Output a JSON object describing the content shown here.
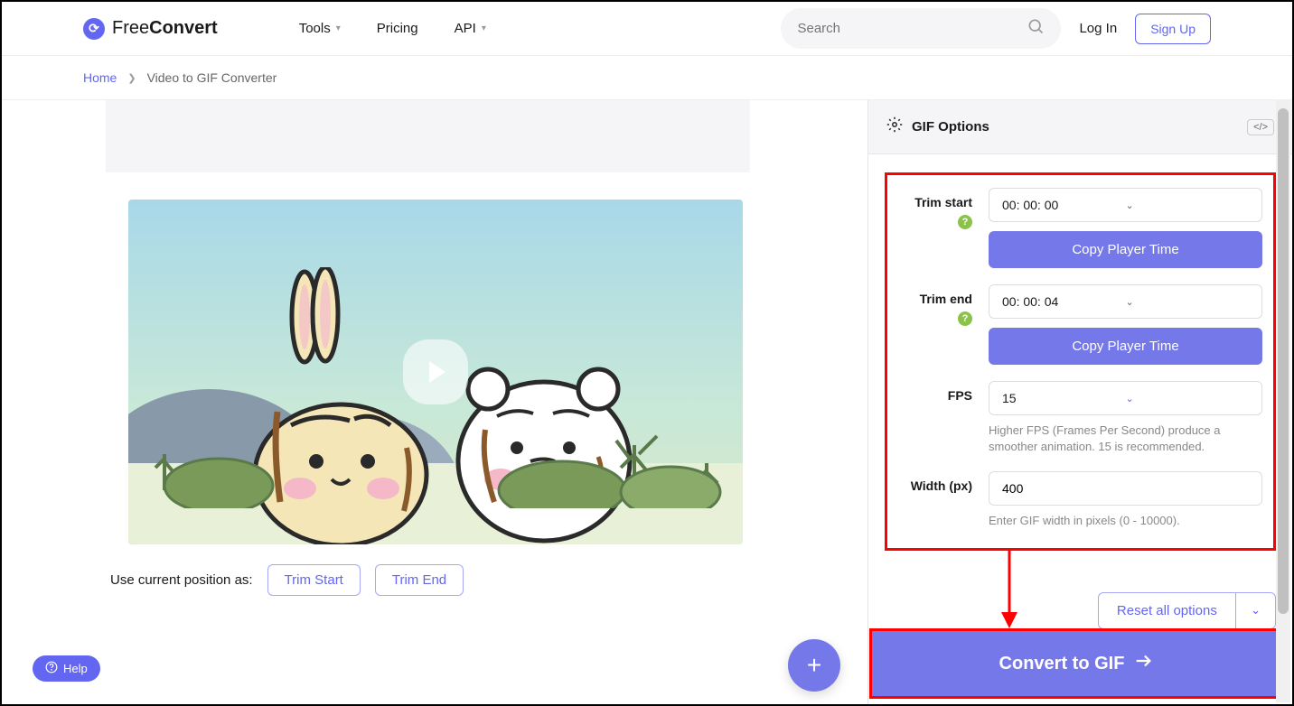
{
  "header": {
    "logo": {
      "prefix": "Free",
      "suffix": "Convert"
    },
    "nav": {
      "tools": "Tools",
      "pricing": "Pricing",
      "api": "API"
    },
    "search_placeholder": "Search",
    "login": "Log In",
    "signup": "Sign Up"
  },
  "breadcrumb": {
    "home": "Home",
    "current": "Video to GIF Converter"
  },
  "trim": {
    "label": "Use current position as:",
    "start_btn": "Trim Start",
    "end_btn": "Trim End"
  },
  "options": {
    "title": "GIF Options",
    "trim_start": {
      "label": "Trim start",
      "value": "00: 00: 00",
      "copy_btn": "Copy Player Time"
    },
    "trim_end": {
      "label": "Trim end",
      "value": "00: 00: 04",
      "copy_btn": "Copy Player Time"
    },
    "fps": {
      "label": "FPS",
      "value": "15",
      "hint": "Higher FPS (Frames Per Second) produce a smoother animation. 15 is recommended."
    },
    "width": {
      "label": "Width (px)",
      "value": "400",
      "hint": "Enter GIF width in pixels (0 - 10000)."
    },
    "reset": "Reset all options"
  },
  "convert_btn": "Convert to GIF",
  "help": "Help"
}
